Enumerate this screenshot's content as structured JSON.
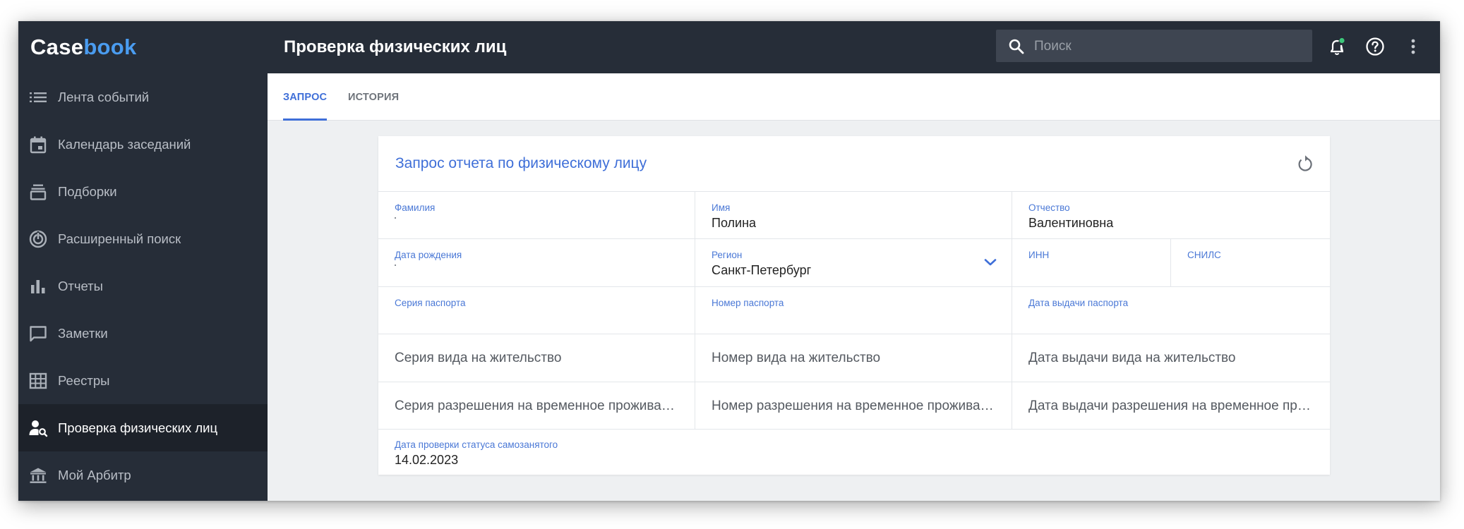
{
  "app": {
    "logo_part1": "Case",
    "logo_part2": "book",
    "brand_color": "#4a9cf0",
    "accent_color": "#3f6fd8"
  },
  "header": {
    "title": "Проверка физических лиц",
    "search_placeholder": "Поиск",
    "icons": [
      "search-icon",
      "notification-bell-icon",
      "help-icon",
      "more-vert-icon"
    ]
  },
  "sidebar": {
    "items": [
      {
        "label": "Лента событий",
        "icon": "list-icon",
        "active": false
      },
      {
        "label": "Календарь заседаний",
        "icon": "calendar-icon",
        "active": false
      },
      {
        "label": "Подборки",
        "icon": "collections-icon",
        "active": false
      },
      {
        "label": "Расширенный поиск",
        "icon": "advanced-search-icon",
        "active": false
      },
      {
        "label": "Отчеты",
        "icon": "bar-chart-icon",
        "active": false
      },
      {
        "label": "Заметки",
        "icon": "note-icon",
        "active": false
      },
      {
        "label": "Реестры",
        "icon": "table-icon",
        "active": false
      },
      {
        "label": "Проверка физических лиц",
        "icon": "person-search-icon",
        "active": true
      },
      {
        "label": "Мой Арбитр",
        "icon": "bank-icon",
        "active": false
      }
    ]
  },
  "tabs": [
    {
      "label": "ЗАПРОС",
      "active": true
    },
    {
      "label": "ИСТОРИЯ",
      "active": false
    }
  ],
  "form": {
    "title": "Запрос отчета по физическому лицу",
    "fields": {
      "surname": {
        "label": "Фамилия",
        "value": ""
      },
      "name": {
        "label": "Имя",
        "value": "Полина"
      },
      "patronymic": {
        "label": "Отчество",
        "value": "Валентиновна"
      },
      "birth_date": {
        "label": "Дата рождения",
        "value": ""
      },
      "region": {
        "label": "Регион",
        "value": "Санкт-Петербург"
      },
      "inn": {
        "label": "ИНН",
        "value": ""
      },
      "snils": {
        "label": "СНИЛС",
        "value": ""
      },
      "passport_series": {
        "label": "Серия паспорта",
        "value": ""
      },
      "passport_number": {
        "label": "Номер паспорта",
        "value": ""
      },
      "passport_date": {
        "label": "Дата выдачи паспорта",
        "value": ""
      },
      "residence_series": {
        "placeholder": "Серия вида на жительство"
      },
      "residence_number": {
        "placeholder": "Номер вида на жительство"
      },
      "residence_date": {
        "placeholder": "Дата выдачи вида на жительство"
      },
      "temp_series": {
        "placeholder": "Серия разрешения на временное проживание"
      },
      "temp_number": {
        "placeholder": "Номер разрешения на временное проживание"
      },
      "temp_date": {
        "placeholder": "Дата выдачи разрешения на временное проживание"
      },
      "selfemployed_date": {
        "label": "Дата проверки статуса самозанятого",
        "value": "14.02.2023"
      }
    }
  }
}
